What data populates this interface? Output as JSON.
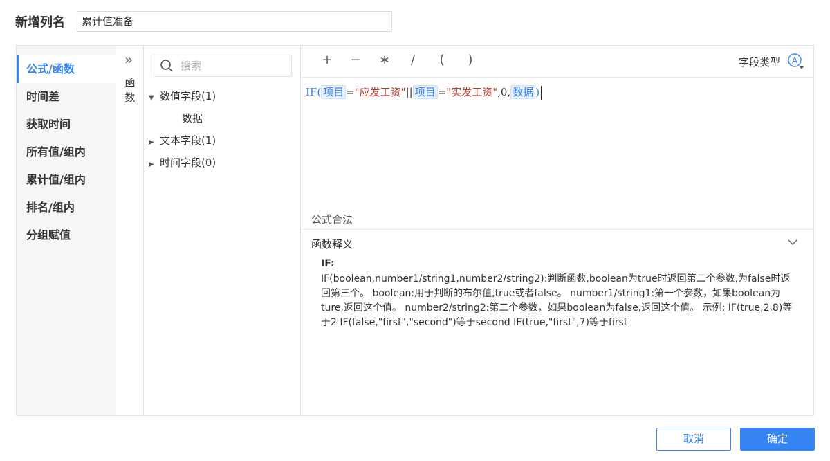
{
  "header": {
    "name_label": "新增列名",
    "name_value": "累计值准备"
  },
  "categories": [
    {
      "label": "公式/函数",
      "active": true
    },
    {
      "label": "时间差"
    },
    {
      "label": "获取时间"
    },
    {
      "label": "所有值/组内"
    },
    {
      "label": "累计值/组内"
    },
    {
      "label": "排名/组内"
    },
    {
      "label": "分组赋值"
    }
  ],
  "functions_tab": {
    "label": "函数"
  },
  "fields": {
    "search_placeholder": "搜索",
    "groups": [
      {
        "label": "数值字段(1)",
        "expanded": true,
        "children": [
          "数据"
        ]
      },
      {
        "label": "文本字段(1)",
        "expanded": false
      },
      {
        "label": "时间字段(0)",
        "expanded": false
      }
    ]
  },
  "toolbar": {
    "operators": [
      "+",
      "−",
      "∗",
      "/",
      "(",
      ")"
    ],
    "field_type_label": "字段类型"
  },
  "formula": {
    "fn_open": "IF(",
    "field1": "项目",
    "eq1": "=",
    "str1": "\"应发工资\"",
    "or": "||",
    "field2": "项目",
    "eq2": "=",
    "str2": "\"实发工资\"",
    "zero": ",0,",
    "field3": "数据",
    "close": ")"
  },
  "validation": {
    "text": "公式合法"
  },
  "description": {
    "title": "函数释义",
    "fn_name": "IF:",
    "body": "IF(boolean,number1/string1,number2/string2):判断函数,boolean为true时返回第二个参数,为false时返回第三个。 boolean:用于判断的布尔值,true或者false。 number1/string1:第一个参数，如果boolean为ture,返回这个值。 number2/string2:第二个参数，如果boolean为false,返回这个值。 示例: IF(true,2,8)等于2 IF(false,\"first\",\"second\")等于second IF(true,\"first\",7)等于first"
  },
  "footer": {
    "cancel_label": "取消",
    "ok_label": "确定"
  },
  "colors": {
    "accent": "#3685f2",
    "string": "#c0392b"
  }
}
